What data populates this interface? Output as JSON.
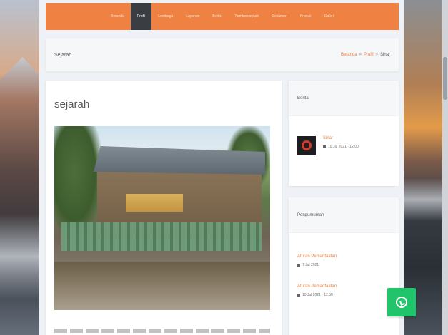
{
  "nav": {
    "items": [
      "Beranda",
      "Profil",
      "Lembaga",
      "Layanan",
      "Berita",
      "Pemberdayaan",
      "Dokumen",
      "Produk",
      "Galeri"
    ],
    "active_index": 1
  },
  "breadcrumb": {
    "title": "Sejarah",
    "trail": [
      "Beranda",
      "Profil",
      "Sinar"
    ]
  },
  "article": {
    "title": "sejarah"
  },
  "sidebar": {
    "berita": {
      "heading": "Berita",
      "item_title": "Sinar",
      "item_meta": "10 Jul 2021 · 12:00"
    },
    "pengumuman": {
      "heading": "Pengumuman",
      "items": [
        {
          "title": "Aturan Pemanfaatan",
          "meta": "7 Jul 2021"
        },
        {
          "title": "Aturan Pemanfaatan",
          "meta": "10 Jul 2021 · 12:00"
        }
      ]
    }
  },
  "whatsapp": {
    "icon": "whatsapp-icon"
  }
}
